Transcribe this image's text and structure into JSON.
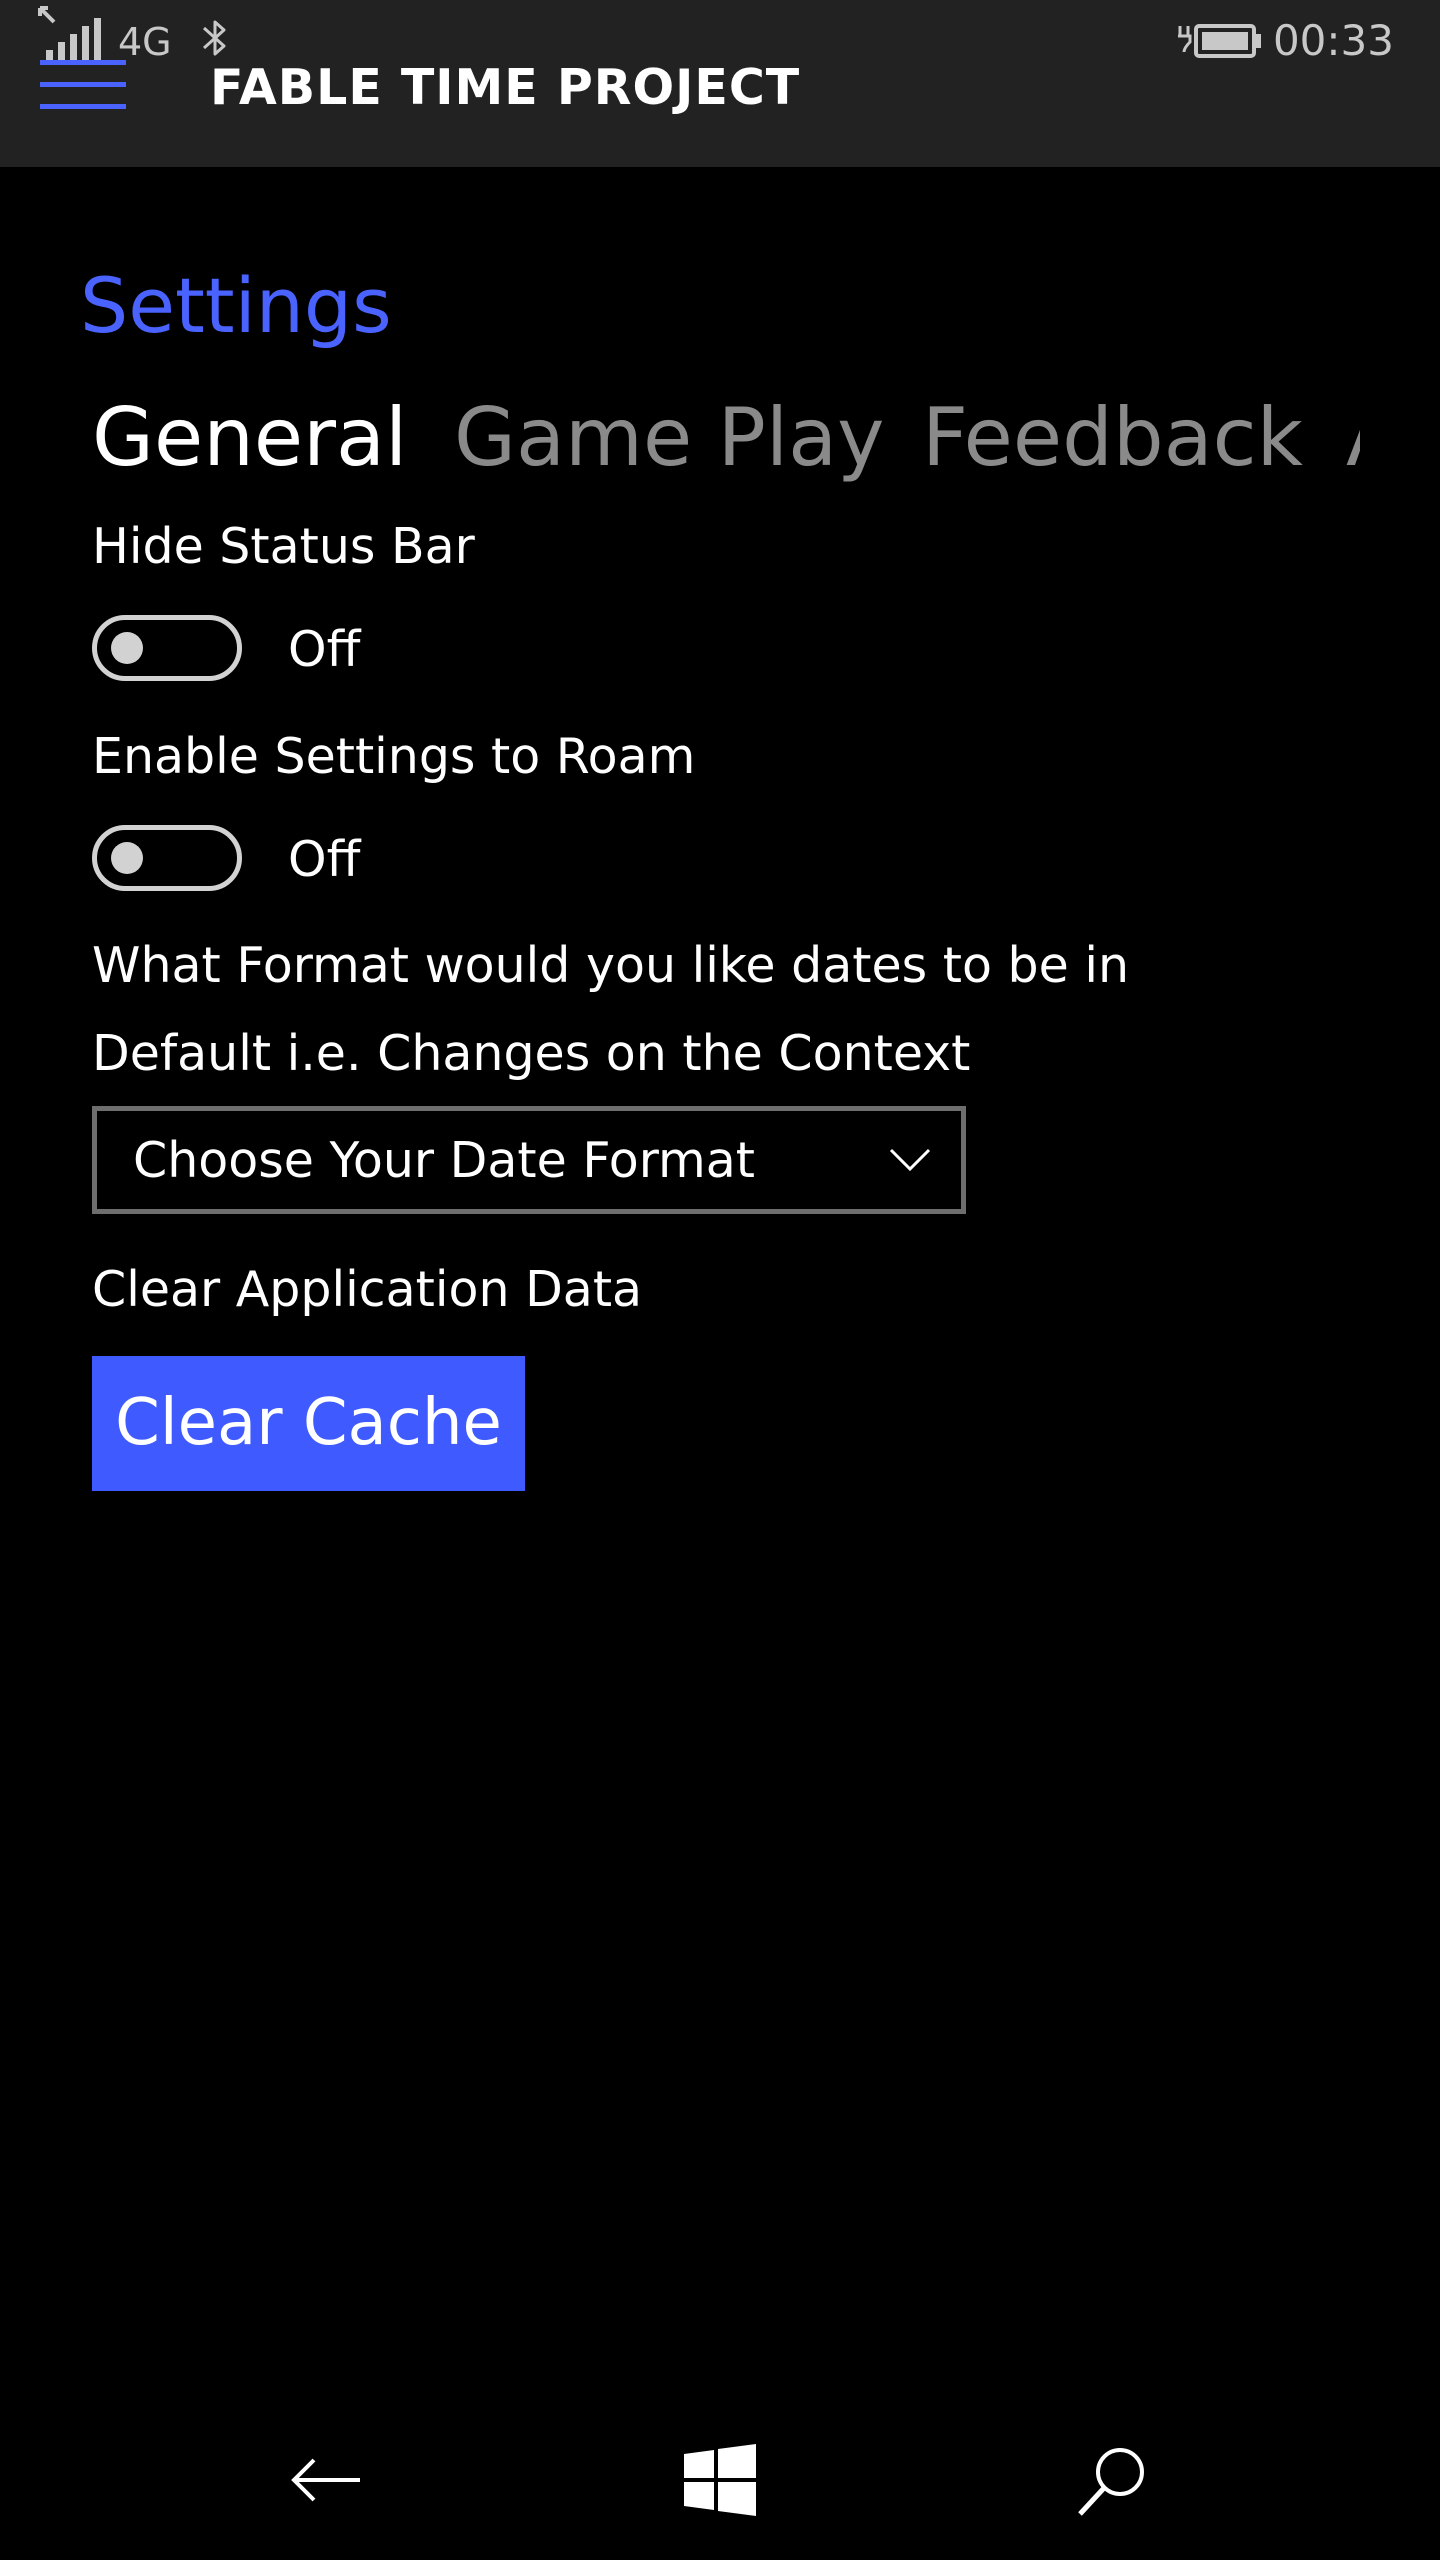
{
  "status_bar": {
    "network": "4G",
    "time": "00:33",
    "icons": [
      "signal-icon",
      "bluetooth-icon",
      "battery-charging-icon"
    ]
  },
  "app_bar": {
    "title": "FABLE TIME PROJECT",
    "menu_icon": "hamburger-icon",
    "accent_color": "#4a63ff"
  },
  "page": {
    "title": "Settings"
  },
  "tabs": [
    {
      "label": "General",
      "active": true
    },
    {
      "label": "Game Play",
      "active": false
    },
    {
      "label": "Feedback",
      "active": false
    },
    {
      "label": "A",
      "active": false
    }
  ],
  "settings": {
    "hide_status_bar": {
      "label": "Hide Status Bar",
      "state": "Off"
    },
    "roam": {
      "label": "Enable Settings to Roam",
      "state": "Off"
    },
    "date_format": {
      "question": "What Format would you like dates to be in",
      "current": "Default i.e. Changes on the Context",
      "placeholder": "Choose Your Date Format"
    },
    "clear_data": {
      "label": "Clear Application Data",
      "button": "Clear Cache"
    }
  },
  "nav_bar": {
    "icons": [
      "back-arrow-icon",
      "windows-logo-icon",
      "search-icon"
    ]
  }
}
